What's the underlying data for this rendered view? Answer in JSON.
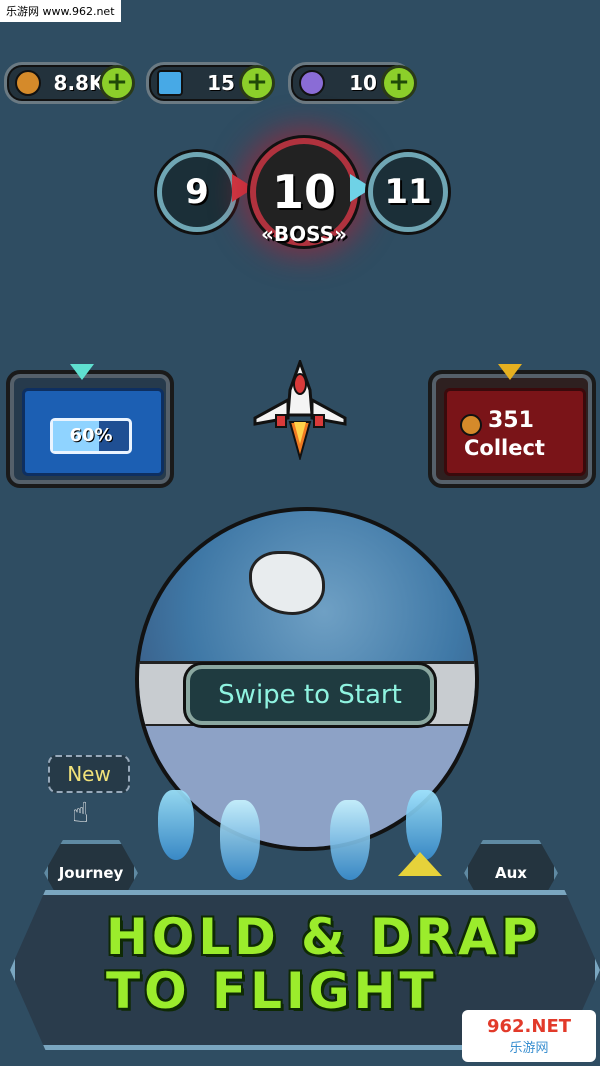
{
  "watermark": "乐游网 www.962.net",
  "resources": {
    "coins": "8.8K",
    "energy": "15",
    "gems": "10",
    "plus": "+"
  },
  "levels": {
    "prev": "9",
    "current": "10",
    "next": "11",
    "boss_label": "«BOSS»"
  },
  "battery": {
    "percent": "60%"
  },
  "collect": {
    "amount": "351",
    "label": "Collect"
  },
  "swipe_label": "Swipe to Start",
  "new_label": "New",
  "journey_label": "Journey",
  "aux_label": "Aux",
  "hold_line1": "HOLD & DRAP",
  "hold_line2": "TO FLIGHT",
  "logo_text": "962.NET",
  "logo_sub": "乐游网",
  "colors": {
    "background": "#2f4d62",
    "accent_green": "#9bec2c",
    "boss_red": "#b0323e",
    "teal": "#6fa6b4"
  }
}
